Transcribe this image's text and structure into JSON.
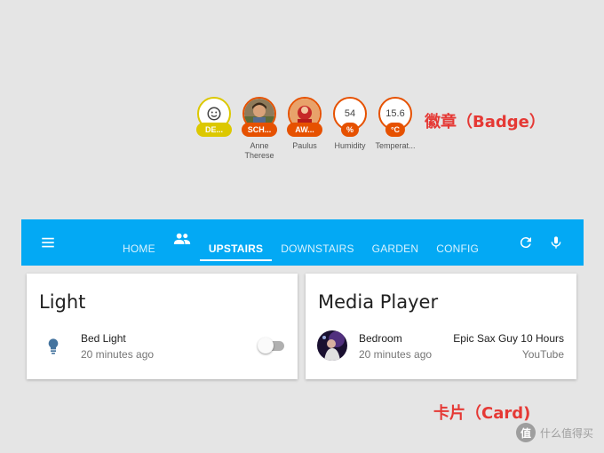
{
  "annotations": {
    "badge_label": "徽章（Badge）",
    "card_label": "卡片（Card)"
  },
  "badges": [
    {
      "icon": "smiley-face-icon",
      "pill": "DE...",
      "label": "",
      "color": "#dcc800"
    },
    {
      "icon": "person-photo-icon",
      "pill": "SCH...",
      "label": "Anne Therese",
      "color": "#e65100"
    },
    {
      "icon": "person-photo-icon",
      "pill": "AW...",
      "label": "Paulus",
      "color": "#e65100"
    },
    {
      "value": "54",
      "pill": "%",
      "label": "Humidity",
      "color": "#e65100"
    },
    {
      "value": "15.6",
      "pill": "°C",
      "label": "Temperat...",
      "color": "#e65100"
    }
  ],
  "toolbar": {
    "background": "#03a9f4",
    "menu_icon": "menu-icon",
    "tabs": [
      "HOME",
      "UPSTAIRS",
      "DOWNSTAIRS",
      "GARDEN",
      "CONFIG"
    ],
    "active_tab": "UPSTAIRS",
    "refresh_icon": "refresh-icon",
    "mic_icon": "microphone-icon"
  },
  "cards": {
    "light": {
      "title": "Light",
      "entity": {
        "icon": "lightbulb-icon",
        "name": "Bed Light",
        "time": "20 minutes ago",
        "state": "off"
      }
    },
    "media": {
      "title": "Media Player",
      "entity": {
        "icon": "media-thumbnail",
        "name": "Bedroom",
        "time": "20 minutes ago",
        "track": "Epic Sax Guy 10 Hours",
        "source": "YouTube"
      }
    }
  },
  "watermark": {
    "logo": "值",
    "text": "什么值得买"
  }
}
